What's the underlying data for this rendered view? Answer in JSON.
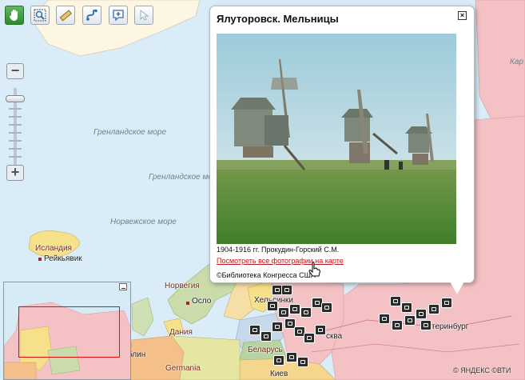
{
  "toolbar": {
    "tools": [
      {
        "name": "pan-tool",
        "icon": "hand-icon",
        "active": true
      },
      {
        "name": "zoom-box-tool",
        "icon": "magnifier-icon",
        "active": false
      },
      {
        "name": "measure-tool",
        "icon": "ruler-icon",
        "active": false
      },
      {
        "name": "route-tool",
        "icon": "route-icon",
        "active": false
      },
      {
        "name": "add-placemark-tool",
        "icon": "placemark-add-icon",
        "active": false
      },
      {
        "name": "select-tool",
        "icon": "arrow-cursor-icon",
        "active": false
      }
    ]
  },
  "zoom": {
    "plus": "+",
    "minus": "−",
    "level_fraction": 0.12
  },
  "map": {
    "seas": {
      "greenland_sea_1": "Гренландское море",
      "greenland_sea_2": "Гренландское море",
      "norwegian_sea": "Норвежское море",
      "kara_fragment": "Кар"
    },
    "countries": {
      "iceland": "Исландия",
      "norway": "Норвегия",
      "denmark": "Дания",
      "belarus": "Беларусь",
      "germany": "Germania"
    },
    "cities": {
      "reykjavik": "Рейкьявик",
      "oslo": "Осло",
      "helsinki": "Хельсинки",
      "moscow": "сква",
      "berlin": "блин",
      "kiev": "Киев",
      "yekaterinburg": "теринбург"
    },
    "copyright": "© ЯНДЕКС ©ВТИ"
  },
  "popup": {
    "title": "Ялуторовск. Мельницы",
    "close": "×",
    "caption": "1904-1916 гг. Прокудин-Горский С.М.",
    "link": "Посмотреть все фотографии на карте",
    "credit": "©Библиотека Конгресса США"
  },
  "colors": {
    "active_tool": "#3a9a3a",
    "link": "#c0161c",
    "sea": "#d9ecf7",
    "land_russia": "#f4c2c4"
  }
}
